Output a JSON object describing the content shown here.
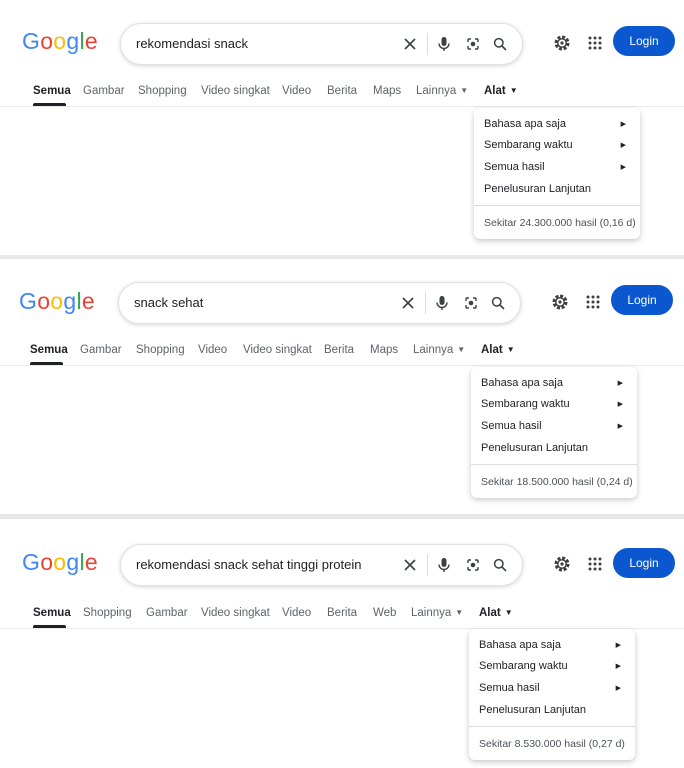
{
  "colors": {
    "login_bg": "#0b57d0",
    "google_blue": "#4285f4",
    "google_red": "#ea4335",
    "google_yellow": "#fbbc05",
    "google_green": "#34a853"
  },
  "logo_text": "Google",
  "login_label": "Login",
  "tools_label": "Alat",
  "more_label": "Lainnya",
  "icons": [
    "clear-icon",
    "mic-icon",
    "lens-icon",
    "search-icon",
    "gear-icon",
    "apps-icon",
    "caret-down-icon",
    "arrow-right-icon"
  ],
  "menu": {
    "item1": "Bahasa apa saja",
    "item2": "Sembarang waktu",
    "item3": "Semua hasil",
    "item4": "Penelusuran Lanjutan"
  },
  "panels": [
    {
      "query": "rekomendasi snack",
      "tabs": [
        "Semua",
        "Gambar",
        "Shopping",
        "Video singkat",
        "Video",
        "Berita",
        "Maps"
      ],
      "result_stats": "Sekitar 24.300.000 hasil (0,16 d)"
    },
    {
      "query": "snack sehat",
      "tabs": [
        "Semua",
        "Gambar",
        "Shopping",
        "Video",
        "Video singkat",
        "Berita",
        "Maps"
      ],
      "result_stats": "Sekitar 18.500.000 hasil (0,24 d)"
    },
    {
      "query": "rekomendasi snack sehat tinggi protein",
      "tabs": [
        "Semua",
        "Shopping",
        "Gambar",
        "Video singkat",
        "Video",
        "Berita",
        "Web"
      ],
      "result_stats": "Sekitar 8.530.000 hasil (0,27 d)"
    }
  ]
}
